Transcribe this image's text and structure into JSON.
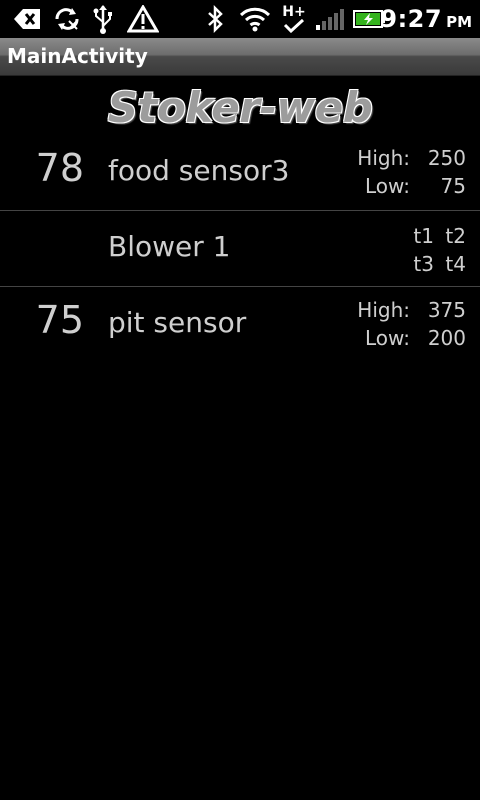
{
  "app_title": "MainActivity",
  "logo_text": "Stoker-web",
  "status_bar": {
    "time": "9:27",
    "ampm": "PM",
    "icons": [
      "back-icon",
      "sync-icon",
      "usb-icon",
      "warning-icon",
      "bluetooth-icon",
      "wifi-icon",
      "hplus-data-icon",
      "signal-icon",
      "battery-charging-icon"
    ],
    "hplus_label": "H+"
  },
  "sensors": [
    {
      "current": "78",
      "name": "food sensor3",
      "high_label": "High:",
      "high": "250",
      "low_label": "Low:",
      "low": "75"
    },
    {
      "current": "",
      "name": "Blower 1",
      "timers": [
        "t1",
        "t2",
        "t3",
        "t4"
      ]
    },
    {
      "current": "75",
      "name": "pit sensor",
      "high_label": "High:",
      "high": "375",
      "low_label": "Low:",
      "low": "200"
    }
  ]
}
